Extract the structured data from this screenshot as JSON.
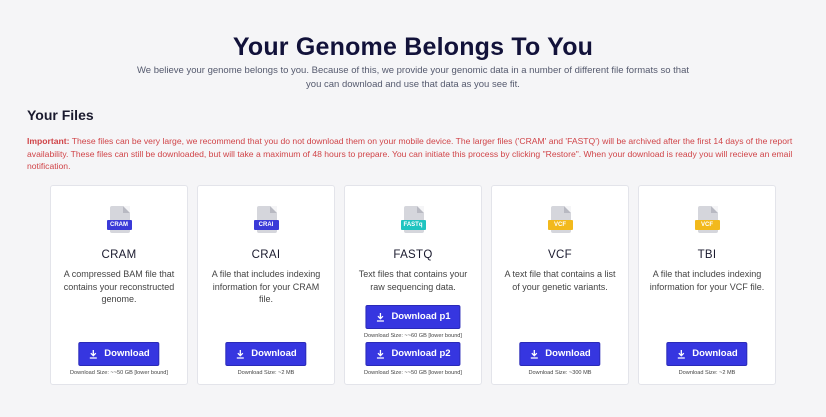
{
  "hero": {
    "title": "Your Genome Belongs To You",
    "subtitle": "We believe your genome belongs to you. Because of this, we provide your genomic data in a number of different file formats so that you can download and use that data as you see fit."
  },
  "files_section": {
    "title": "Your Files",
    "warning_label": "Important:",
    "warning_text": " These files can be very large, we recommend that you do not download them on your mobile device. The larger files ('CRAM' and 'FASTQ') will be archived after the first 14 days of the report availability. These files can still be downloaded, but will take a maximum of 48 hours to prepare. You can initiate this process by clicking \"Restore\". When your download is ready you will recieve an email notification."
  },
  "cards": [
    {
      "tag": "CRAM",
      "tag_color": "#3a3ad8",
      "name": "CRAM",
      "desc": "A compressed BAM file that contains your reconstructed genome.",
      "button": "Download",
      "size": "Download Size: ~~50 GB [lower bound]"
    },
    {
      "tag": "CRAI",
      "tag_color": "#3a3ad8",
      "name": "CRAI",
      "desc": "A file that includes indexing information for your CRAM file.",
      "button": "Download",
      "size": "Download Size: ~2 MB"
    },
    {
      "tag": "FASTq",
      "tag_color": "#1fc4c0",
      "name": "FASTQ",
      "desc": "Text files that contains your raw sequencing data.",
      "button_p1": "Download p1",
      "size_p1": "Download Size: ~~60 GB [lower bound]",
      "button_p2": "Download p2",
      "size_p2": "Download Size: ~~50 GB [lower bound]"
    },
    {
      "tag": "VCF",
      "tag_color": "#f2b91c",
      "name": "VCF",
      "desc": "A text file that contains a list of your genetic variants.",
      "button": "Download",
      "size": "Download Size: ~300 MB"
    },
    {
      "tag": "VCF",
      "tag_color": "#f2b91c",
      "name": "TBI",
      "desc": "A file that includes indexing information for your VCF file.",
      "button": "Download",
      "size": "Download Size: ~2 MB"
    }
  ],
  "colors": {
    "accent": "#3636e0",
    "warning": "#d04448",
    "title": "#12123a"
  },
  "icons": {
    "download": "download-icon",
    "file": "file-icon"
  }
}
